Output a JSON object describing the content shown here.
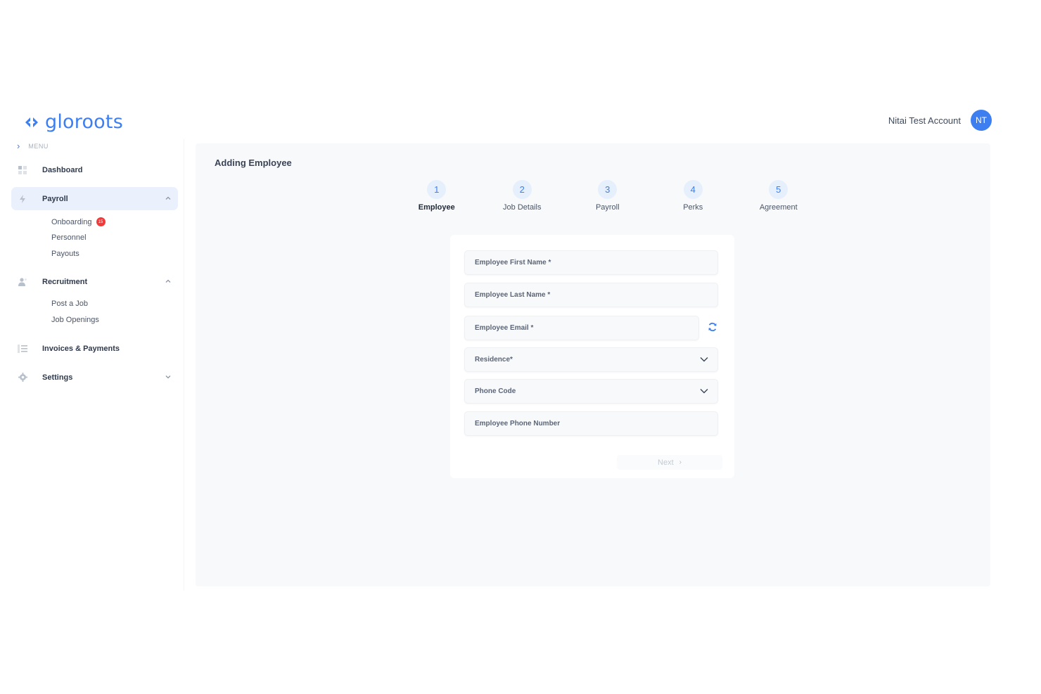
{
  "brand": {
    "name": "gloroots",
    "color": "#3d7ff0"
  },
  "account": {
    "name": "Nitai Test Account",
    "initials": "NT"
  },
  "sidebar": {
    "menu_label": "MENU",
    "items": [
      {
        "label": "Dashboard",
        "icon": "grid-icon"
      },
      {
        "label": "Payroll",
        "icon": "bolt-icon",
        "expanded": true,
        "children": [
          {
            "label": "Onboarding",
            "badge": "15"
          },
          {
            "label": "Personnel"
          },
          {
            "label": "Payouts"
          }
        ]
      },
      {
        "label": "Recruitment",
        "icon": "user-icon",
        "expanded": true,
        "children": [
          {
            "label": "Post a Job"
          },
          {
            "label": "Job Openings"
          }
        ]
      },
      {
        "label": "Invoices & Payments",
        "icon": "list-icon"
      },
      {
        "label": "Settings",
        "icon": "gear-icon",
        "expanded": false
      }
    ]
  },
  "main": {
    "title": "Adding Employee",
    "steps": [
      {
        "number": "1",
        "label": "Employee",
        "active": true
      },
      {
        "number": "2",
        "label": "Job Details"
      },
      {
        "number": "3",
        "label": "Payroll"
      },
      {
        "number": "4",
        "label": "Perks"
      },
      {
        "number": "5",
        "label": "Agreement"
      }
    ],
    "form": {
      "first_name": "Employee First Name *",
      "last_name": "Employee Last Name *",
      "email": "Employee Email *",
      "residence": "Residence*",
      "phone_code": "Phone Code",
      "phone_number": "Employee Phone Number",
      "next": "Next"
    }
  }
}
